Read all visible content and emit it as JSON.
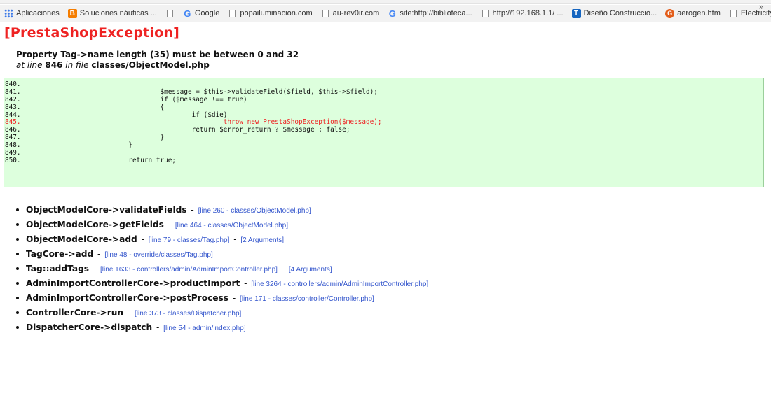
{
  "bookmarks": [
    {
      "icon": "apps-icon",
      "label": "Aplicaciones"
    },
    {
      "icon": "blogger-icon",
      "label": "Soluciones náuticas ..."
    },
    {
      "icon": "page-icon",
      "label": ""
    },
    {
      "icon": "google-icon",
      "label": "Google"
    },
    {
      "icon": "page-icon",
      "label": "popailuminacion.com"
    },
    {
      "icon": "page-icon",
      "label": "au-rev0ir.com"
    },
    {
      "icon": "google-icon",
      "label": "site:http://biblioteca..."
    },
    {
      "icon": "page-icon",
      "label": "http://192.168.1.1/ ..."
    },
    {
      "icon": "t-icon",
      "label": "Diseño Construcció..."
    },
    {
      "icon": "aerogen-icon",
      "label": "aerogen.htm"
    },
    {
      "icon": "page-icon",
      "label": "Electricity with Step..."
    }
  ],
  "bookmarks_more": "»",
  "error": {
    "title": "[PrestaShopException]",
    "message": "Property Tag->name length (35) must be between 0 and 32",
    "location_prefix": "at line",
    "line": "846",
    "location_mid": "in file",
    "file": "classes/ObjectModel.php"
  },
  "code": [
    {
      "ln": "840.",
      "src": ""
    },
    {
      "ln": "841.",
      "src": "                        $message = $this->validateField($field, $this->$field);"
    },
    {
      "ln": "842.",
      "src": "                        if ($message !== true)"
    },
    {
      "ln": "843.",
      "src": "                        {"
    },
    {
      "ln": "844.",
      "src": "                                if ($die)"
    },
    {
      "ln": "845.",
      "src": "                                        throw new PrestaShopException($message);"
    },
    {
      "ln": "846.",
      "src": "                                return $error_return ? $message : false;"
    },
    {
      "ln": "847.",
      "src": "                        }"
    },
    {
      "ln": "848.",
      "src": "                }"
    },
    {
      "ln": "849.",
      "src": ""
    },
    {
      "ln": "850.",
      "src": "                return true;"
    }
  ],
  "highlight_line": "845.",
  "colors": {
    "error_title": "#ee2222",
    "code_bg": "#ddffdd",
    "link": "#3355cc"
  },
  "trace": [
    {
      "fn": "ObjectModelCore->validateFields",
      "link": "[line 260 - classes/ObjectModel.php]",
      "extra": ""
    },
    {
      "fn": "ObjectModelCore->getFields",
      "link": "[line 464 - classes/ObjectModel.php]",
      "extra": ""
    },
    {
      "fn": "ObjectModelCore->add",
      "link": "[line 79 - classes/Tag.php]",
      "extra": "[2 Arguments]"
    },
    {
      "fn": "TagCore->add",
      "link": "[line 48 - override/classes/Tag.php]",
      "extra": ""
    },
    {
      "fn": "Tag::addTags",
      "link": "[line 1633 - controllers/admin/AdminImportController.php]",
      "extra": "[4 Arguments]"
    },
    {
      "fn": "AdminImportControllerCore->productImport",
      "link": "[line 3264 - controllers/admin/AdminImportController.php]",
      "extra": ""
    },
    {
      "fn": "AdminImportControllerCore->postProcess",
      "link": "[line 171 - classes/controller/Controller.php]",
      "extra": ""
    },
    {
      "fn": "ControllerCore->run",
      "link": "[line 373 - classes/Dispatcher.php]",
      "extra": ""
    },
    {
      "fn": "DispatcherCore->dispatch",
      "link": "[line 54 - admin/index.php]",
      "extra": ""
    }
  ]
}
